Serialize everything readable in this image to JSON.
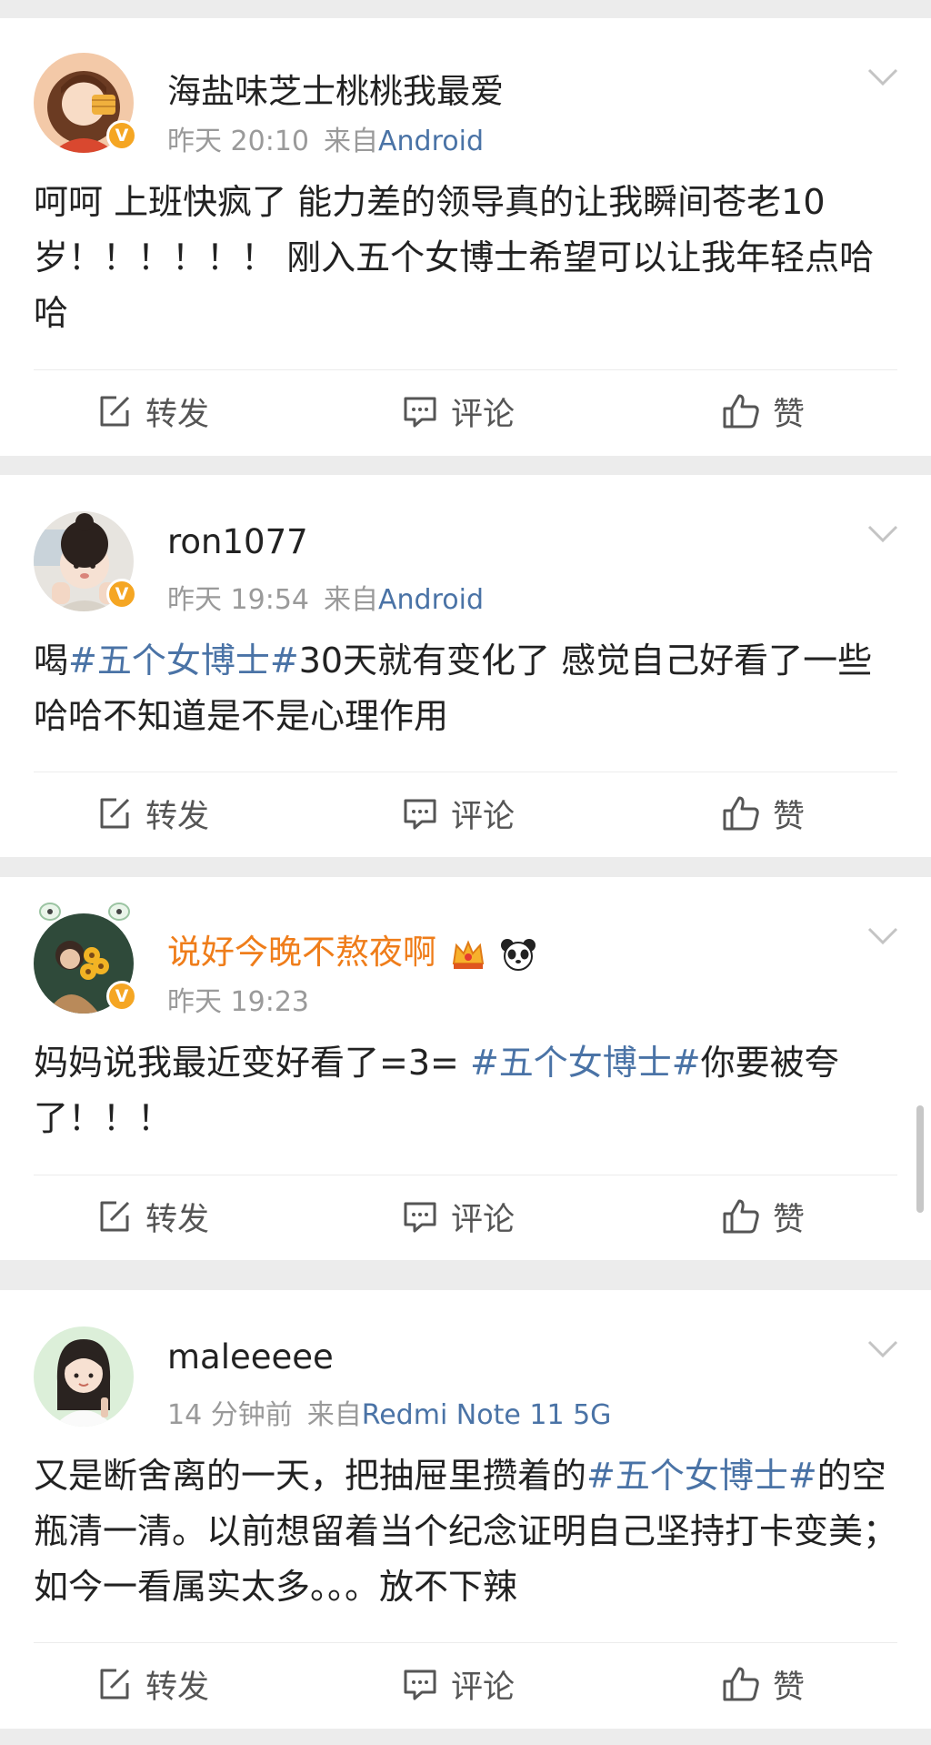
{
  "actions": {
    "repost": "转发",
    "comment": "评论",
    "like": "赞"
  },
  "posts": [
    {
      "username": "海盐味芝士桃桃我最爱",
      "time": "昨天 20:10",
      "via": "来自",
      "source": "Android",
      "text": "呵呵 上班快疯了 能力差的领导真的让我瞬间苍老10岁！！！！！！ 刚入五个女博士希望可以让我年轻点哈哈"
    },
    {
      "username": "ron1077",
      "time": "昨天 19:54",
      "via": "来自",
      "source": "Android",
      "text_before": "喝",
      "hashtag": "#五个女博士#",
      "text_after": "30天就有变化了 感觉自己好看了一些 哈哈不知道是不是心理作用"
    },
    {
      "username": "说好今晚不熬夜啊",
      "time": "昨天 19:23",
      "text_before": "妈妈说我最近变好看了=3= ",
      "hashtag": "#五个女博士#",
      "text_after": "你要被夸了！！！"
    },
    {
      "username": "maleeeee",
      "time": "14 分钟前",
      "via": "来自",
      "source": "Redmi Note 11 5G",
      "text_before": "又是断舍离的一天，把抽屉里攒着的",
      "hashtag": "#五个女博士#",
      "text_after": "的空瓶清一清。以前想留着当个纪念证明自己坚持打卡变美；如今一看属实太多。。。放不下辣"
    }
  ]
}
